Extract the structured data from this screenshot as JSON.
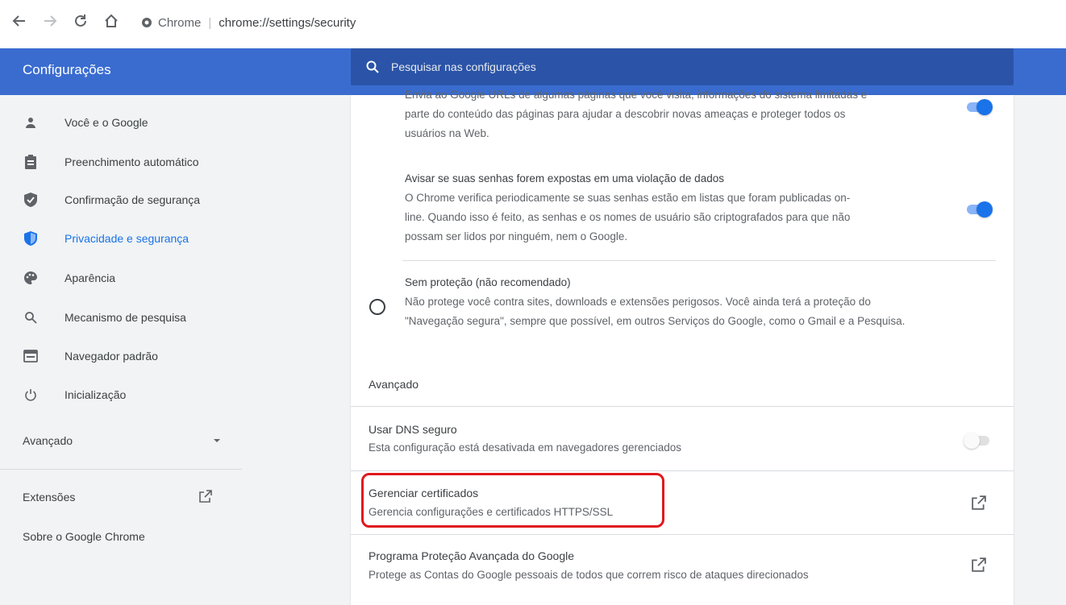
{
  "browser": {
    "site_name": "Chrome",
    "separator": "|",
    "url": "chrome://settings/security"
  },
  "header": {
    "title": "Configurações",
    "search_placeholder": "Pesquisar nas configurações"
  },
  "sidebar": {
    "items": [
      {
        "label": "Você e o Google",
        "icon": "person-icon"
      },
      {
        "label": "Preenchimento automático",
        "icon": "clipboard-icon"
      },
      {
        "label": "Confirmação de segurança",
        "icon": "shield-check-icon"
      },
      {
        "label": "Privacidade e segurança",
        "icon": "shield-icon",
        "active": true
      },
      {
        "label": "Aparência",
        "icon": "palette-icon"
      },
      {
        "label": "Mecanismo de pesquisa",
        "icon": "search-icon"
      },
      {
        "label": "Navegador padrão",
        "icon": "browser-window-icon"
      },
      {
        "label": "Inicialização",
        "icon": "power-icon"
      }
    ],
    "advanced_label": "Avançado",
    "extensions_label": "Extensões",
    "about_label": "Sobre o Google Chrome"
  },
  "content": {
    "enhanced_desc_line0": "Envia ao Google URLs de algumas páginas que você visita, informações do sistema limitadas e",
    "enhanced_desc_line1": "parte do conteúdo das páginas para ajudar a descobrir novas ameaças e proteger todos os",
    "enhanced_desc_line2": "usuários na Web.",
    "password_title": "Avisar se suas senhas forem expostas em uma violação de dados",
    "password_desc_line1": "O Chrome verifica periodicamente se suas senhas estão em listas que foram publicadas on-",
    "password_desc_line2": "line. Quando isso é feito, as senhas e os nomes de usuário são criptografados para que não",
    "password_desc_line3": "possam ser lidos por ninguém, nem o Google.",
    "no_protection_title": "Sem proteção (não recomendado)",
    "no_protection_line1": "Não protege você contra sites, downloads e extensões perigosos. Você ainda terá a proteção do",
    "no_protection_line2": "\"Navegação segura\", sempre que possível, em outros Serviços do Google, como o Gmail e a Pesquisa.",
    "advanced_heading": "Avançado",
    "dns_title": "Usar DNS seguro",
    "dns_desc": "Esta configuração está desativada em navegadores gerenciados",
    "cert_title": "Gerenciar certificados",
    "cert_desc": "Gerencia configurações e certificados HTTPS/SSL",
    "app_title": "Programa Proteção Avançada do Google",
    "app_desc": "Protege as Contas do Google pessoais de todos que correm risco de ataques direcionados"
  },
  "colors": {
    "header": "#3a6cd0",
    "search": "#2b54a8",
    "accent": "#1a73e8",
    "highlight": "#e0181d"
  }
}
